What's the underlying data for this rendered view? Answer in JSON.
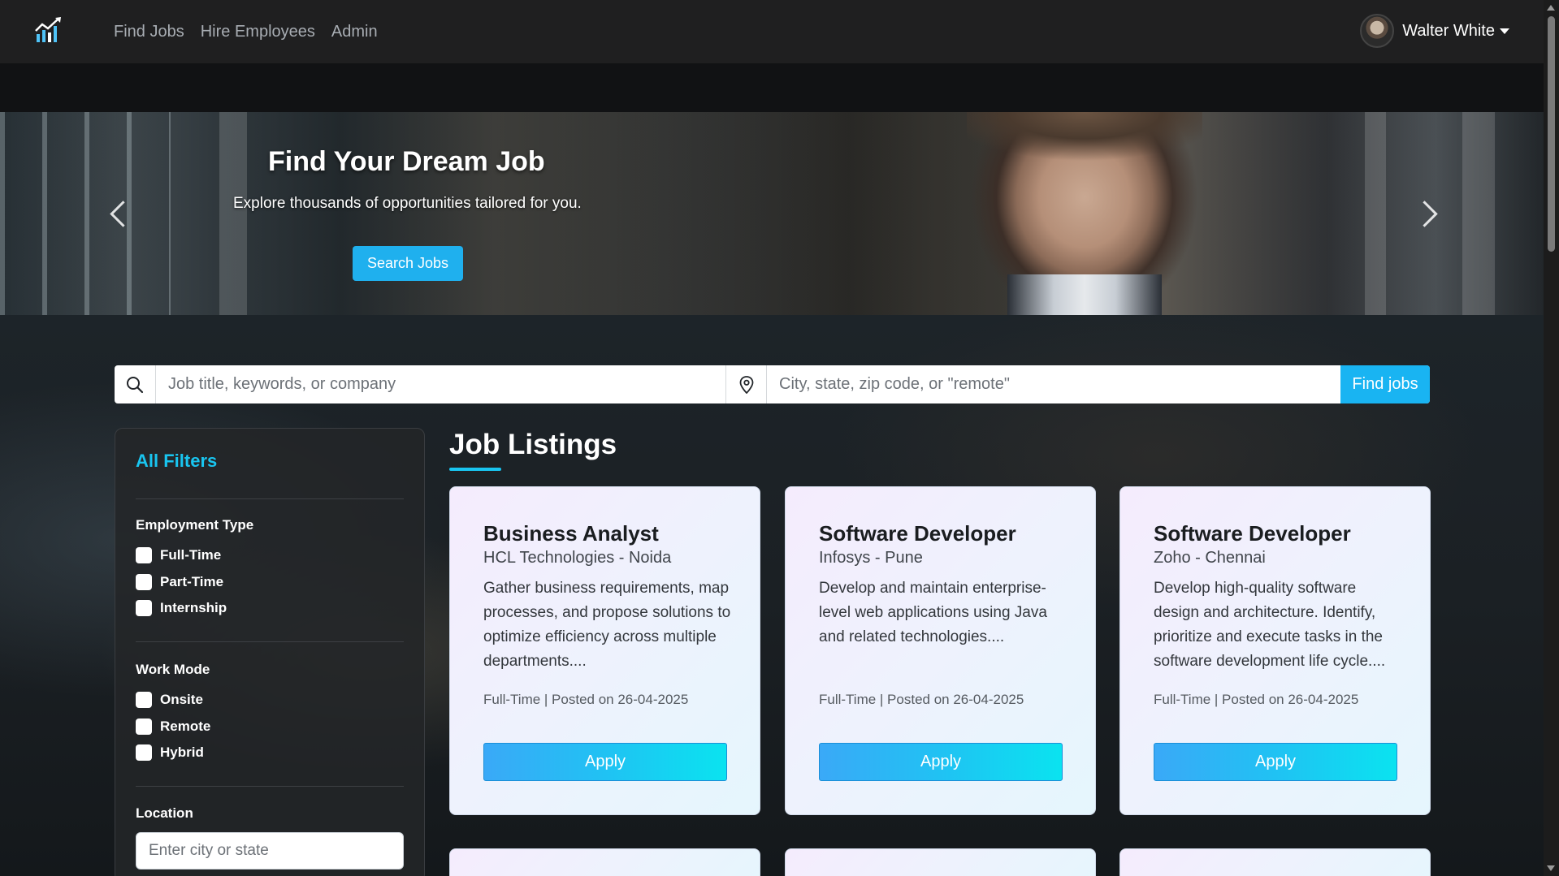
{
  "nav": {
    "links": [
      "Find Jobs",
      "Hire Employees",
      "Admin"
    ],
    "user_name": "Walter White"
  },
  "hero": {
    "title": "Find Your Dream Job",
    "subtitle": "Explore thousands of opportunities tailored for you.",
    "button_label": "Search Jobs"
  },
  "search": {
    "keyword_placeholder": "Job title, keywords, or company",
    "location_placeholder": "City, state, zip code, or \"remote\"",
    "button_label": "Find jobs"
  },
  "filters": {
    "title": "All Filters",
    "employment_type": {
      "heading": "Employment Type",
      "options": [
        "Full-Time",
        "Part-Time",
        "Internship"
      ]
    },
    "work_mode": {
      "heading": "Work Mode",
      "options": [
        "Onsite",
        "Remote",
        "Hybrid"
      ]
    },
    "location": {
      "heading": "Location",
      "placeholder": "Enter city or state"
    }
  },
  "listings": {
    "title": "Job Listings",
    "jobs": [
      {
        "title": "Business Analyst",
        "company": "HCL Technologies - Noida",
        "description": "Gather business requirements, map processes, and propose solutions to optimize efficiency across multiple departments....",
        "meta": "Full-Time | Posted on 26-04-2025",
        "apply_label": "Apply"
      },
      {
        "title": "Software Developer",
        "company": "Infosys - Pune",
        "description": "Develop and maintain enterprise-level web applications using Java and related technologies....",
        "meta": "Full-Time | Posted on 26-04-2025",
        "apply_label": "Apply"
      },
      {
        "title": "Software Developer",
        "company": "Zoho - Chennai",
        "description": "Develop high-quality software design and architecture. Identify, prioritize and execute tasks in the software development life cycle....",
        "meta": "Full-Time | Posted on 26-04-2025",
        "apply_label": "Apply"
      }
    ]
  },
  "colors": {
    "accent": "#19c5f0",
    "nav_bg": "#1f1f20",
    "button_blue": "#19b4f2"
  },
  "icons": [
    "app-logo-icon",
    "search-icon",
    "location-pin-icon",
    "chevron-left-icon",
    "chevron-right-icon",
    "caret-down-icon"
  ]
}
